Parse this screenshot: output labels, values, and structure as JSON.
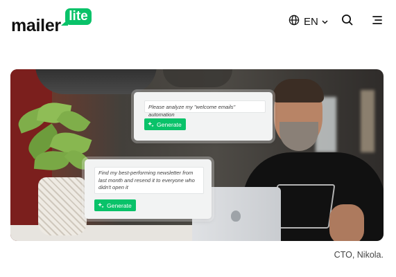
{
  "brand": {
    "logo_word": "mailer",
    "logo_badge": "lite",
    "accent_color": "#09c269"
  },
  "header": {
    "language": "EN",
    "icons": [
      "globe-icon",
      "chevron-down-icon",
      "search-icon",
      "hamburger-menu-icon"
    ]
  },
  "hero": {
    "prompt_cards": [
      {
        "text": "Please analyze my \"welcome emails\" automation",
        "button_label": "Generate"
      },
      {
        "text": "Find my best-performing newsletter from last month and resend it to everyone who didn't open it",
        "button_label": "Generate"
      }
    ],
    "caption": "CTO, Nikola."
  }
}
